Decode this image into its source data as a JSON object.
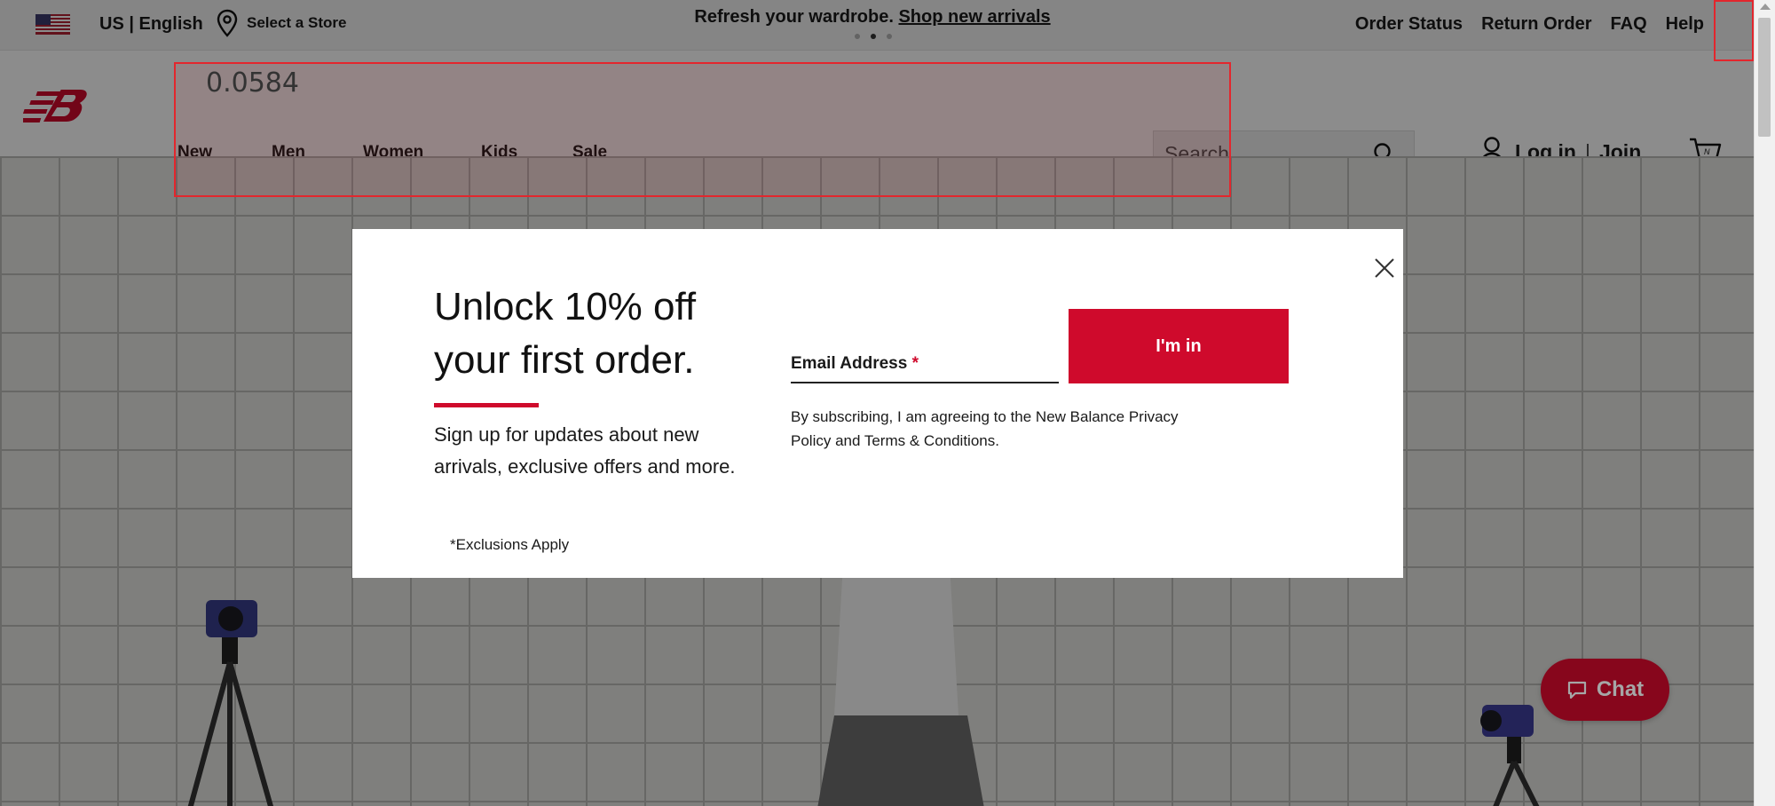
{
  "utility_bar": {
    "locale": "US | English",
    "store_label": "Select a Store",
    "promo_text": "Refresh your wardrobe.",
    "promo_link": "Shop new arrivals",
    "links": [
      "Order Status",
      "Return Order",
      "FAQ",
      "Help"
    ]
  },
  "nav": {
    "items": [
      "New",
      "Men",
      "Women",
      "Kids",
      "Sale"
    ],
    "search_placeholder": "Search",
    "login_label": "Log in",
    "join_label": "Join"
  },
  "debug": {
    "score_label": "0.0584"
  },
  "modal": {
    "heading": "Unlock 10% off your first order.",
    "subtext": "Sign up for updates about new arrivals, exclusive offers and more.",
    "exclusions": "*Exclusions Apply",
    "email_label": "Email Address",
    "required_marker": "*",
    "submit_label": "I'm in",
    "legal_text": "By subscribing, I am agreeing to the New Balance Privacy Policy and Terms & Conditions."
  },
  "chat": {
    "label": "Chat"
  },
  "colors": {
    "brand_red": "#cf0a2c",
    "debug_box": "#e3262d"
  },
  "icons": [
    "us-flag-icon",
    "location-pin-icon",
    "nb-logo",
    "search-icon",
    "user-icon",
    "cart-icon",
    "close-icon",
    "chat-bubble-icon"
  ]
}
